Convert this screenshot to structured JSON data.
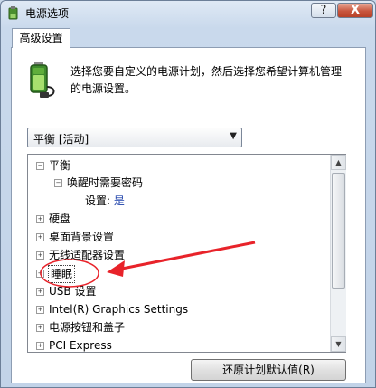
{
  "window": {
    "title": "电源选项",
    "help_label": "?",
    "close_label": "X"
  },
  "tab": {
    "label": "高级设置"
  },
  "description": "选择您要自定义的电源计划，然后选择您希望计算机管理的电源设置。",
  "plan_select": {
    "value": "平衡 [活动]"
  },
  "tree": {
    "plan": "平衡",
    "wake_password": "唤醒时需要密码",
    "setting_label": "设置:",
    "setting_value": "是",
    "items": [
      "硬盘",
      "桌面背景设置",
      "无线适配器设置",
      "睡眠",
      "USB 设置",
      "Intel(R) Graphics Settings",
      "电源按钮和盖子",
      "PCI Express"
    ],
    "selected": "睡眠"
  },
  "restore_button": {
    "label": "还原计划默认值(R)"
  },
  "colors": {
    "annotation_red": "#e8232a",
    "link_blue": "#1a3ea8"
  },
  "icons": {
    "app": "power-options-icon",
    "battery": "battery-plug-icon",
    "expand": "plus-box",
    "collapse": "minus-box"
  }
}
